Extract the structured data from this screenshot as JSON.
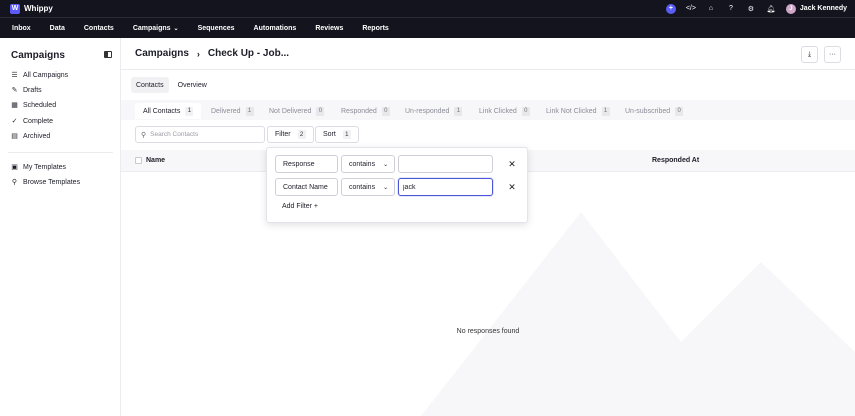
{
  "app": {
    "name": "Whippy"
  },
  "user": {
    "name": "Jack Kennedy",
    "initials": "J"
  },
  "nav": [
    "Inbox",
    "Data",
    "Contacts",
    "Campaigns",
    "Sequences",
    "Automations",
    "Reviews",
    "Reports"
  ],
  "sidebar": {
    "title": "Campaigns",
    "items": [
      {
        "label": "All Campaigns",
        "icon": "list-icon"
      },
      {
        "label": "Drafts",
        "icon": "pencil-icon"
      },
      {
        "label": "Scheduled",
        "icon": "calendar-icon"
      },
      {
        "label": "Complete",
        "icon": "check-circle-icon"
      },
      {
        "label": "Archived",
        "icon": "archive-icon"
      }
    ],
    "template_items": [
      {
        "label": "My Templates",
        "icon": "template-icon"
      },
      {
        "label": "Browse Templates",
        "icon": "search-icon"
      }
    ]
  },
  "header": {
    "section": "Campaigns",
    "title": "Check Up - Job..."
  },
  "view_tabs": [
    "Contacts",
    "Overview"
  ],
  "status_tabs": [
    {
      "label": "All Contacts",
      "count": "1"
    },
    {
      "label": "Delivered",
      "count": "1"
    },
    {
      "label": "Not Delivered",
      "count": "0"
    },
    {
      "label": "Responded",
      "count": "0"
    },
    {
      "label": "Un-responded",
      "count": "1"
    },
    {
      "label": "Link Clicked",
      "count": "0"
    },
    {
      "label": "Link Not Clicked",
      "count": "1"
    },
    {
      "label": "Un-subscribed",
      "count": "0"
    }
  ],
  "search": {
    "placeholder": "Search Contacts",
    "value": ""
  },
  "filter": {
    "label": "Filter",
    "count": "2"
  },
  "sort": {
    "label": "Sort",
    "count": "1"
  },
  "table": {
    "columns": [
      "Name",
      "Responded At"
    ]
  },
  "filters": [
    {
      "field": "Response",
      "operator": "contains",
      "value": ""
    },
    {
      "field": "Contact Name",
      "operator": "contains",
      "value": "jack"
    }
  ],
  "add_filter_label": "Add Filter +",
  "empty_message": "No responses found",
  "colors": {
    "topbar": "#14141f",
    "accent": "#5b5cf6",
    "focus": "#4a55d8"
  }
}
